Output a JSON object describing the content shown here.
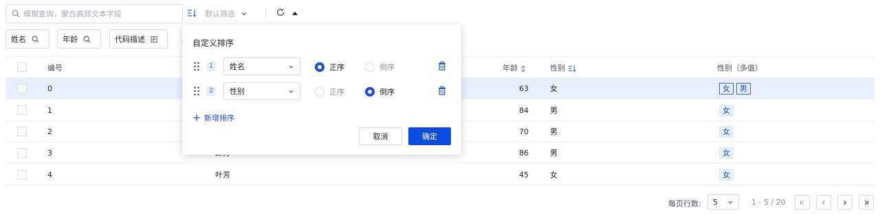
{
  "toolbar": {
    "search_placeholder": "模糊查询，聚合高频文本字段",
    "filter_label": "默认筛选",
    "icons": [
      "search-icon",
      "sort-icon",
      "chevron-down-icon",
      "refresh-icon",
      "caret-up-icon"
    ]
  },
  "filters": [
    {
      "label": "姓名",
      "icon": "search-icon"
    },
    {
      "label": "年龄",
      "icon": "search-icon"
    },
    {
      "label": "代码描述",
      "icon": "filter-list-icon"
    }
  ],
  "filter_overflow_glyph": "+",
  "table": {
    "headers": {
      "id": "编号",
      "name": "",
      "age": "年龄",
      "gender": "性别",
      "gender_multi": "性别（多值）"
    },
    "rows": [
      {
        "id": "0",
        "name": "",
        "age": "63",
        "gender": "女",
        "gender_multi": [
          "女",
          "男"
        ],
        "selected": true
      },
      {
        "id": "1",
        "name": "",
        "age": "84",
        "gender": "男",
        "gender_multi": [
          "女"
        ],
        "selected": false
      },
      {
        "id": "2",
        "name": "",
        "age": "70",
        "gender": "男",
        "gender_multi": [
          "女"
        ],
        "selected": false
      },
      {
        "id": "3",
        "name": "邱芳",
        "age": "86",
        "gender": "男",
        "gender_multi": [
          "女"
        ],
        "selected": false
      },
      {
        "id": "4",
        "name": "叶芳",
        "age": "45",
        "gender": "女",
        "gender_multi": [
          "女"
        ],
        "selected": false
      }
    ]
  },
  "pagination": {
    "rows_per_page_label": "每页行数:",
    "rows_per_page": "5",
    "range": "1 - 5 / 20"
  },
  "sort_popover": {
    "title": "自定义排序",
    "rules": [
      {
        "index": "1",
        "field": "姓名",
        "asc_label": "正序",
        "desc_label": "倒序",
        "order": "asc"
      },
      {
        "index": "2",
        "field": "性别",
        "asc_label": "正序",
        "desc_label": "倒序",
        "order": "desc"
      }
    ],
    "add_label": "新增排序",
    "cancel_label": "取消",
    "confirm_label": "确定"
  },
  "colors": {
    "primary": "#0b4de0",
    "selected_row": "#e8f0fd",
    "tag_border": "#2f6fed",
    "border": "#d9dce3"
  }
}
